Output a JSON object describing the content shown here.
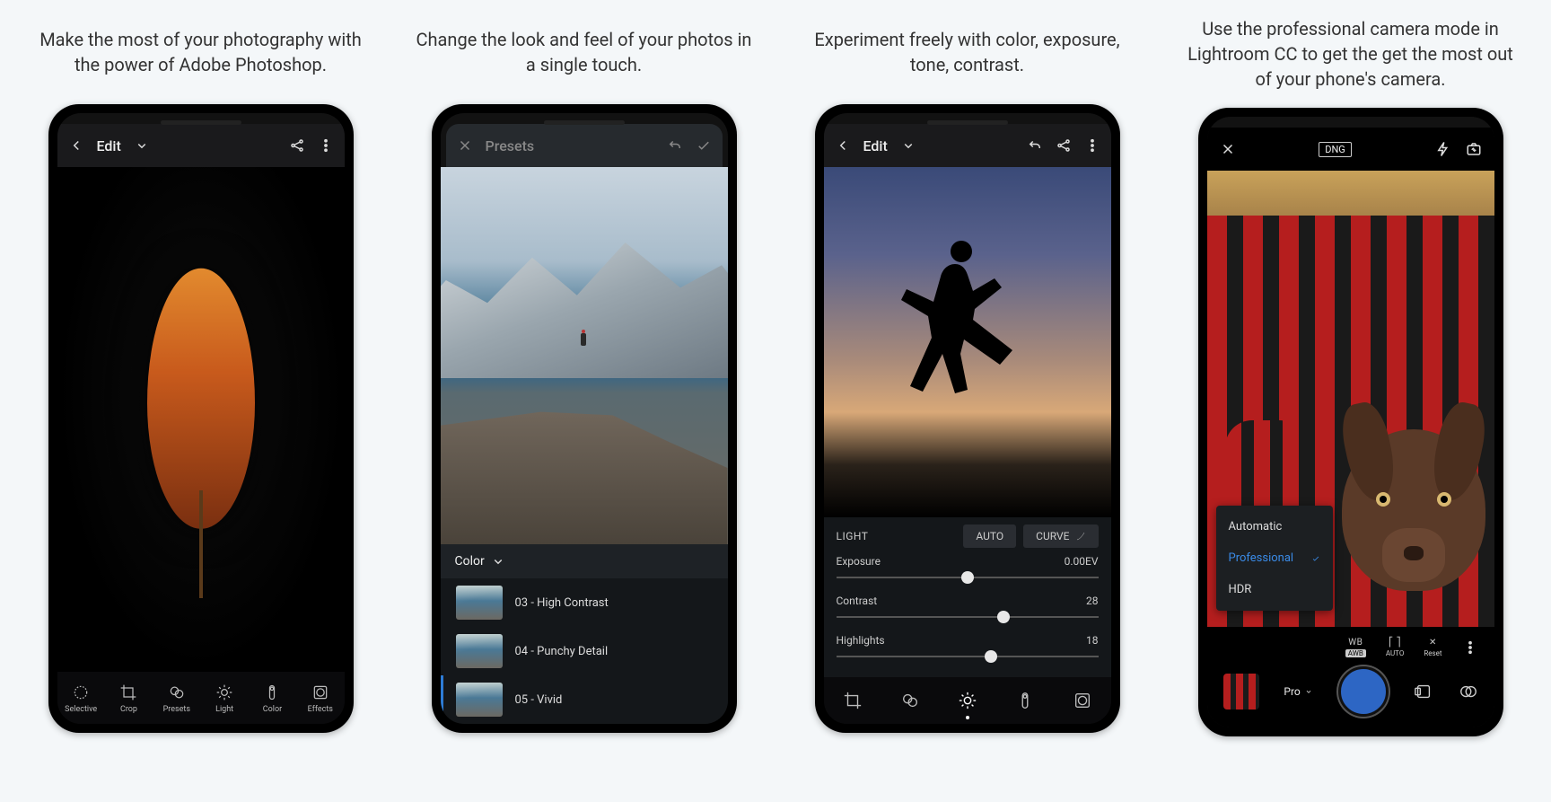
{
  "captions": [
    "Make the most of your photography with the power of Adobe Photoshop.",
    "Change the look and feel of your photos in a single touch.",
    "Experiment freely with color, exposure, tone, contrast.",
    "Use the professional camera mode in Lightroom CC to get the get the most out of your phone's camera."
  ],
  "screen1": {
    "title": "Edit",
    "tools": [
      "Selective",
      "Crop",
      "Presets",
      "Light",
      "Color",
      "Effects"
    ]
  },
  "screen2": {
    "title": "Presets",
    "colorLabel": "Color",
    "presets": [
      {
        "label": "03 - High Contrast"
      },
      {
        "label": "04 - Punchy Detail"
      },
      {
        "label": "05 - Vivid"
      }
    ]
  },
  "screen3": {
    "title": "Edit",
    "section": "LIGHT",
    "auto": "AUTO",
    "curve": "CURVE",
    "sliders": [
      {
        "name": "Exposure",
        "value": "0.00EV",
        "pos": 50
      },
      {
        "name": "Contrast",
        "value": "28",
        "pos": 64
      },
      {
        "name": "Highlights",
        "value": "18",
        "pos": 59
      }
    ]
  },
  "screen4": {
    "dng": "DNG",
    "modes": {
      "auto": "Automatic",
      "pro": "Professional",
      "hdr": "HDR"
    },
    "wb": {
      "label": "WB",
      "badge": "AWB"
    },
    "focus": {
      "label": "[ ]",
      "sub": "AUTO"
    },
    "reset": "Reset",
    "proLabel": "Pro"
  }
}
